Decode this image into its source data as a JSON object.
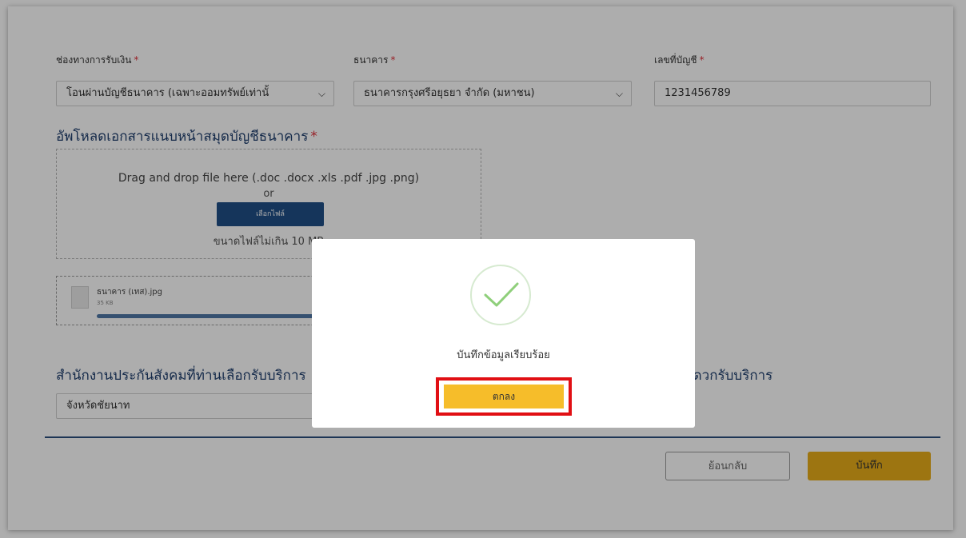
{
  "form": {
    "payment_channel": {
      "label": "ช่องทางการรับเงิน",
      "required_mark": "*",
      "value": "โอนผ่านบัญชีธนาคาร (เฉพาะออมทรัพย์เท่านั้"
    },
    "bank": {
      "label": "ธนาคาร",
      "required_mark": "*",
      "value": "ธนาคารกรุงศรีอยุธยา จำกัด (มหาชน)"
    },
    "account_no": {
      "label": "เลขที่บัญชี",
      "required_mark": "*",
      "value": "1231456789"
    },
    "upload": {
      "title": "อัพโหลดเอกสารแนบหน้าสมุดบัญชีธนาคาร",
      "required_mark": "*",
      "drop_text": "Drag and drop file here (.doc .docx .xls .pdf .jpg .png)",
      "or_text": "or",
      "choose_button": "เลือกไฟล์",
      "size_limit": "ขนาดไฟล์ไม่เกิน 10 MB",
      "file": {
        "name": "ธนาคาร (เทส).jpg",
        "size": "35 KB",
        "progress": 1.0
      }
    },
    "office_left": {
      "title": "สำนักงานประกันสังคมที่ท่านเลือกรับบริการ",
      "value": "จังหวัดชัยนาท"
    },
    "office_right": {
      "title": "สำนักงานประกันสังคมที่ท่านสะดวกรับบริการ"
    },
    "buttons": {
      "back": "ย้อนกลับ",
      "save": "บันทึก"
    }
  },
  "modal": {
    "icon": "check-icon",
    "message": "บันทึกข้อมูลเรียบร้อย",
    "ok_button": "ตกลง"
  },
  "colors": {
    "primary": "#1f4f86",
    "accent": "#f6bd2a",
    "highlight": "#e10f14",
    "required": "#e0303a"
  }
}
